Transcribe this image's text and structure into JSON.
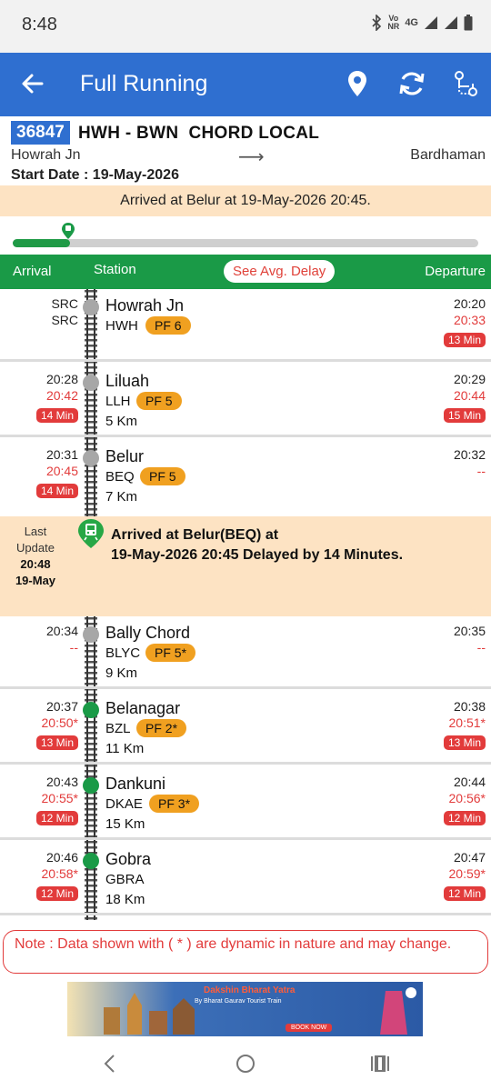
{
  "status_bar": {
    "time": "8:48",
    "network_small_top": "Vo",
    "network_small_bottom": "NR",
    "network_type": "4G",
    "roaming": "R",
    "icons": [
      "bluetooth-icon",
      "signal-icon",
      "signal-icon",
      "battery-icon"
    ]
  },
  "app_bar": {
    "title": "Full Running",
    "icons": [
      "back-arrow-icon",
      "location-pin-icon",
      "refresh-icon",
      "route-icon"
    ]
  },
  "train": {
    "number": "36847",
    "name": "HWH - BWN  CHORD LOCAL",
    "from": "Howrah Jn",
    "arrow": "⟶",
    "to": "Bardhaman",
    "start_date": "Start Date : 19-May-2026"
  },
  "arrived_banner": "Arrived at Belur at 19-May-2026 20:45.",
  "progress": {
    "fraction": 0.065
  },
  "table_header": {
    "arrival": "Arrival",
    "station": "Station",
    "avg_delay_button": "See Avg. Delay",
    "departure": "Departure"
  },
  "stations": [
    {
      "name": "Howrah Jn",
      "code": "HWH",
      "pf": "PF 6",
      "km": "",
      "sched_arr": "SRC",
      "act_arr": "SRC",
      "arr_delay": "",
      "sched_dep": "20:20",
      "act_dep": "20:33",
      "dep_delay": "13 Min",
      "status": "passed"
    },
    {
      "name": "Liluah",
      "code": "LLH",
      "pf": "PF 5",
      "km": "5 Km",
      "sched_arr": "20:28",
      "act_arr": "20:42",
      "arr_delay": "14 Min",
      "sched_dep": "20:29",
      "act_dep": "20:44",
      "dep_delay": "15 Min",
      "status": "passed"
    },
    {
      "name": "Belur",
      "code": "BEQ",
      "pf": "PF 5",
      "km": "7 Km",
      "sched_arr": "20:31",
      "act_arr": "20:45",
      "arr_delay": "14 Min",
      "sched_dep": "20:32",
      "act_dep": "--",
      "dep_delay": "",
      "status": "passed"
    },
    {
      "name": "Bally Chord",
      "code": "BLYC",
      "pf": "PF 5*",
      "km": "9 Km",
      "sched_arr": "20:34",
      "act_arr": "--",
      "arr_delay": "",
      "sched_dep": "20:35",
      "act_dep": "--",
      "dep_delay": "",
      "status": "passed"
    },
    {
      "name": "Belanagar",
      "code": "BZL",
      "pf": "PF 2*",
      "km": "11 Km",
      "sched_arr": "20:37",
      "act_arr": "20:50*",
      "arr_delay": "13 Min",
      "sched_dep": "20:38",
      "act_dep": "20:51*",
      "dep_delay": "13 Min",
      "status": "upcoming"
    },
    {
      "name": "Dankuni",
      "code": "DKAE",
      "pf": "PF 3*",
      "km": "15 Km",
      "sched_arr": "20:43",
      "act_arr": "20:55*",
      "arr_delay": "12 Min",
      "sched_dep": "20:44",
      "act_dep": "20:56*",
      "dep_delay": "12 Min",
      "status": "upcoming"
    },
    {
      "name": "Gobra",
      "code": "GBRA",
      "pf": "",
      "km": "18 Km",
      "sched_arr": "20:46",
      "act_arr": "20:58*",
      "arr_delay": "12 Min",
      "sched_dep": "20:47",
      "act_dep": "20:59*",
      "dep_delay": "12 Min",
      "status": "upcoming"
    }
  ],
  "last_update": {
    "label_line1": "Last",
    "label_line2": "Update",
    "time": "20:48",
    "date": "19-May",
    "message_line1": "Arrived at Belur(BEQ) at",
    "message_line2": "19-May-2026 20:45 Delayed by 14 Minutes."
  },
  "note": "Note : Data shown with ( * ) are dynamic in nature and may change.",
  "ad": {
    "title": "Dakshin Bharat Yatra",
    "subtitle": "By Bharat Gaurav Tourist Train",
    "button": "BOOK NOW"
  },
  "colors": {
    "primary": "#2f6fd0",
    "green": "#1a9a47",
    "delay_red": "#e23b3b",
    "pf_orange": "#f0a020",
    "banner_peach": "#fde3c3"
  }
}
